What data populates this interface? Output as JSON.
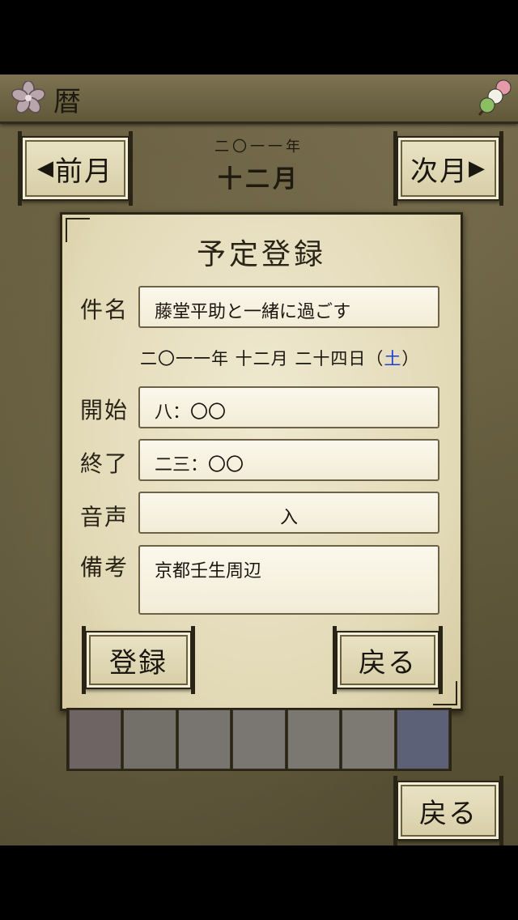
{
  "header": {
    "title": "暦"
  },
  "nav": {
    "prev_label": "前月",
    "next_label": "次月",
    "year": "二〇一一年",
    "month": "十二月"
  },
  "dialog": {
    "title": "予定登録",
    "subject_label": "件名",
    "subject_value": "藤堂平助と一緒に過ごす",
    "date_text": "二〇一一年  十二月  二十四日（",
    "date_weekday": "土",
    "date_close": "）",
    "start_label": "開始",
    "start_value": "八：〇〇",
    "end_label": "終了",
    "end_value": "二三：〇〇",
    "sound_label": "音声",
    "sound_value": "入",
    "note_label": "備考",
    "note_value": "京都壬生周辺",
    "register_label": "登録",
    "back_label": "戻る"
  },
  "palette": {
    "colors": [
      "#6e6463",
      "#737069",
      "#787570",
      "#7a7772",
      "#7b7871",
      "#7d7a74",
      "#5d6178"
    ]
  },
  "footer": {
    "back_label": "戻る"
  }
}
